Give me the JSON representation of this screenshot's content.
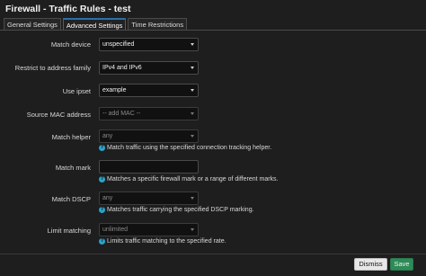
{
  "window": {
    "title": "Firewall - Traffic Rules - test"
  },
  "tabs": [
    {
      "label": "General Settings"
    },
    {
      "label": "Advanced Settings"
    },
    {
      "label": "Time Restrictions"
    }
  ],
  "fields": {
    "match_device": {
      "label": "Match device",
      "value": "unspecified"
    },
    "address_family": {
      "label": "Restrict to address family",
      "value": "IPv4 and IPv6"
    },
    "ipset": {
      "label": "Use ipset",
      "value": "example"
    },
    "source_mac": {
      "label": "Source MAC address",
      "placeholder": "-- add MAC --"
    },
    "helper": {
      "label": "Match helper",
      "value": "any",
      "hint": "Match traffic using the specified connection tracking helper."
    },
    "mark": {
      "label": "Match mark",
      "value": "",
      "hint": "Matches a specific firewall mark or a range of different marks."
    },
    "dscp": {
      "label": "Match DSCP",
      "value": "any",
      "hint": "Matches traffic carrying the specified DSCP marking."
    },
    "limit": {
      "label": "Limit matching",
      "value": "unlimited",
      "hint": "Limits traffic matching to the specified rate."
    }
  },
  "footer": {
    "dismiss_label": "Dismiss",
    "save_label": "Save"
  },
  "colors": {
    "accent_tab": "#2b6fa8",
    "save_button": "#2e8b57",
    "help_icon": "#2aa3c9"
  }
}
